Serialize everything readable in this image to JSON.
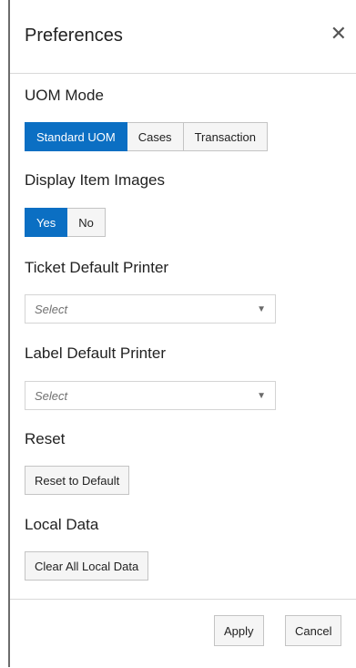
{
  "dialog": {
    "title": "Preferences",
    "close_icon": "close-icon"
  },
  "uom_mode": {
    "label": "UOM Mode",
    "options": [
      "Standard UOM",
      "Cases",
      "Transaction"
    ],
    "selected": "Standard UOM"
  },
  "display_item_images": {
    "label": "Display Item Images",
    "options": [
      "Yes",
      "No"
    ],
    "selected": "Yes"
  },
  "ticket_printer": {
    "label": "Ticket Default Printer",
    "placeholder": "Select"
  },
  "label_printer": {
    "label": "Label Default Printer",
    "placeholder": "Select"
  },
  "reset": {
    "label": "Reset",
    "button": "Reset to Default"
  },
  "local_data": {
    "label": "Local Data",
    "button": "Clear All Local Data"
  },
  "footer": {
    "apply": "Apply",
    "cancel": "Cancel"
  },
  "colors": {
    "accent": "#0b6fc3",
    "button_bg": "#f5f5f5",
    "border": "#c4c4c4"
  }
}
